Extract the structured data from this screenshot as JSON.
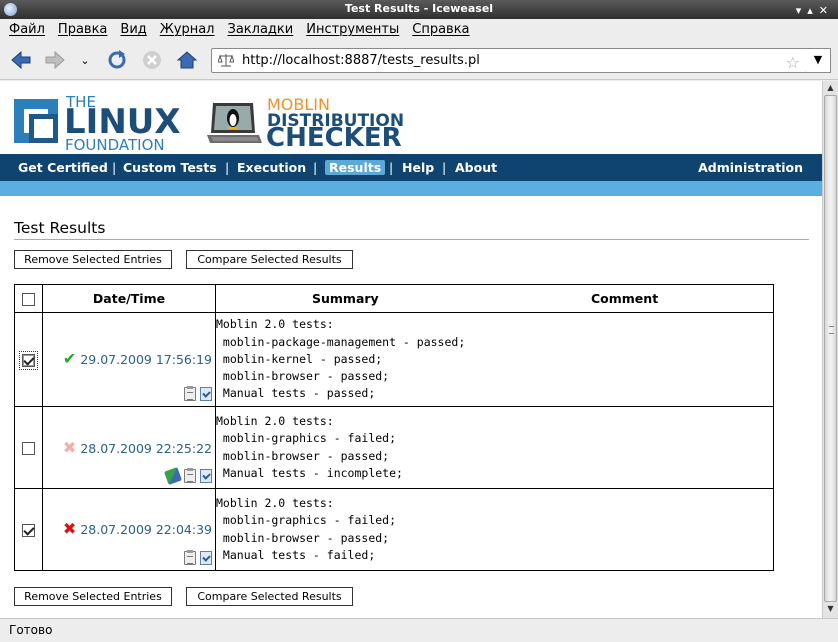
{
  "window": {
    "title": "Test Results - Iceweasel"
  },
  "menubar": {
    "items": [
      "Файл",
      "Правка",
      "Вид",
      "Журнал",
      "Закладки",
      "Инструменты",
      "Справка"
    ]
  },
  "urlbar": {
    "url": "http://localhost:8887/tests_results.pl"
  },
  "header": {
    "lf_the": "THE",
    "lf_linux": "LINUX",
    "lf_foundation": "FOUNDATION",
    "moblin": "MOBLIN",
    "distribution": "DISTRIBUTION",
    "checker": "CHECKER"
  },
  "sitenav": {
    "items": [
      "Get Certified",
      "Custom Tests",
      "Execution",
      "Results",
      "Help",
      "About"
    ],
    "active": "Results",
    "admin": "Administration"
  },
  "page": {
    "title": "Test Results",
    "remove_button": "Remove Selected Entries",
    "compare_button": "Compare Selected Results"
  },
  "table": {
    "headers": {
      "datetime": "Date/Time",
      "summary": "Summary",
      "comment": "Comment"
    },
    "rows": [
      {
        "checked": true,
        "status": "passed",
        "datetime": "29.07.2009 17:56:19",
        "summary": "Moblin 2.0 tests:\n moblin-package-management - passed;\n moblin-kernel - passed;\n moblin-browser - passed;\n Manual tests - passed;",
        "icons": [
          "clipboard-icon",
          "compare-icon"
        ]
      },
      {
        "checked": false,
        "status": "failed-faded",
        "datetime": "28.07.2009 22:25:22",
        "summary": "Moblin 2.0 tests:\n moblin-graphics - failed;\n moblin-browser - passed;\n Manual tests - incomplete;",
        "icons": [
          "edit-icon",
          "clipboard-icon",
          "compare-icon"
        ]
      },
      {
        "checked": true,
        "status": "failed",
        "datetime": "28.07.2009 22:04:39",
        "summary": "Moblin 2.0 tests:\n moblin-graphics - failed;\n moblin-browser - passed;\n Manual tests - failed;",
        "icons": [
          "clipboard-icon",
          "compare-icon"
        ]
      }
    ]
  },
  "statusbar": {
    "text": "Готово"
  },
  "colors": {
    "nav_dark": "#0f4470",
    "nav_light": "#5aaee0",
    "link": "#2a5e90",
    "pass": "#22aa22",
    "fail": "#dd1111"
  }
}
